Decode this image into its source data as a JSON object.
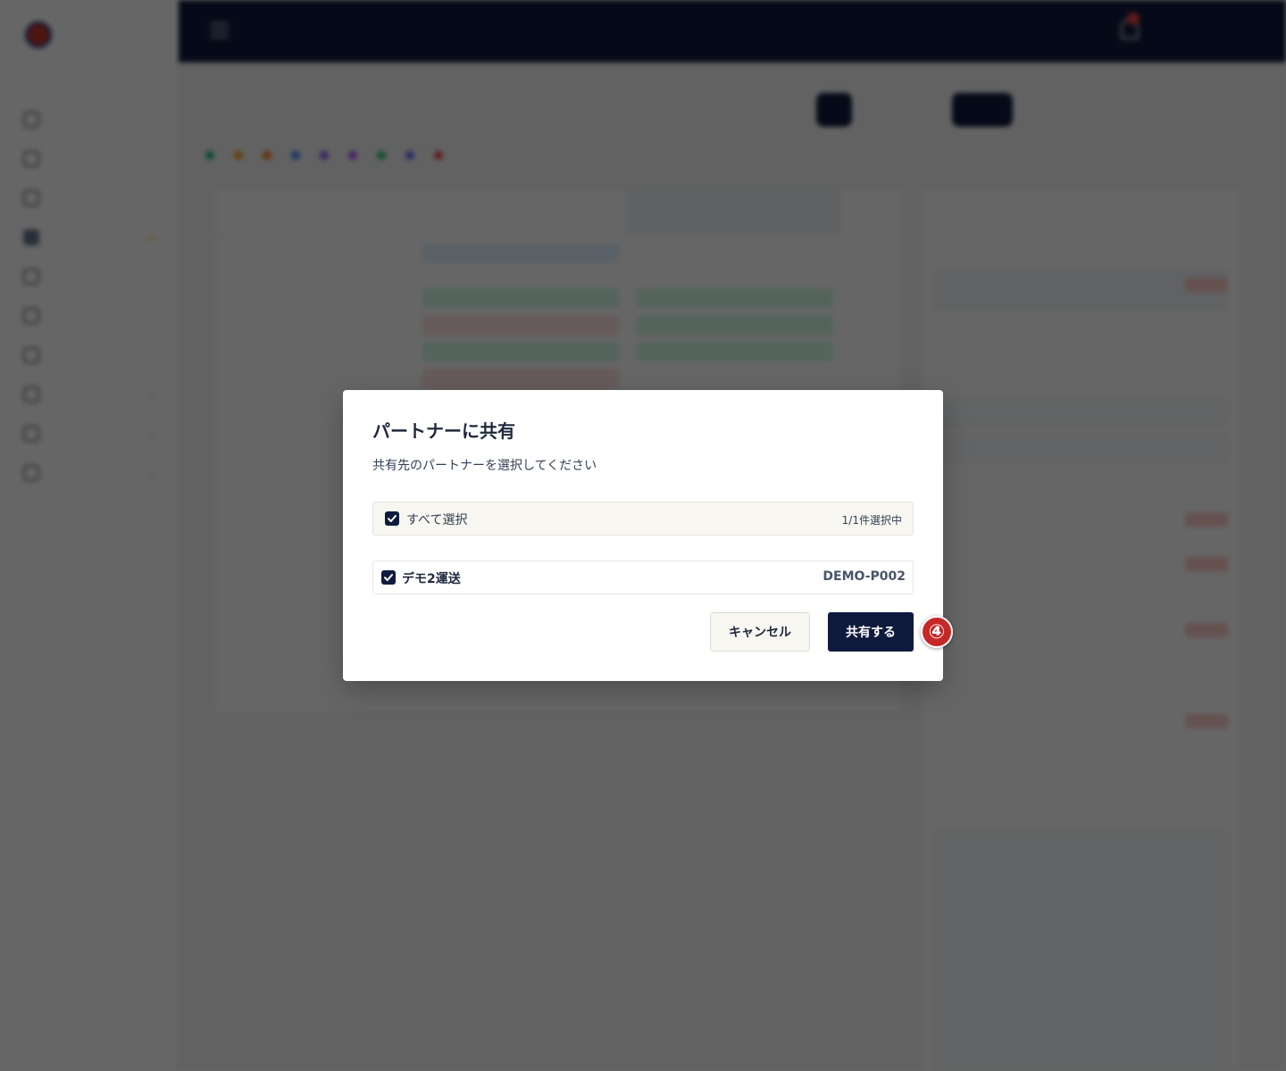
{
  "dialog": {
    "title": "パートナーに共有",
    "subtitle": "共有先のパートナーを選択してください",
    "select_all_label": "すべて選択",
    "selected_count": "1/1件選択中",
    "partners": [
      {
        "name": "デモ2運送",
        "code": "DEMO-P002",
        "checked": true
      }
    ],
    "cancel_label": "キャンセル",
    "share_label": "共有する"
  },
  "annotation": {
    "step_badge": "④"
  },
  "colors": {
    "primary": "#0f1b3d",
    "overlay": "rgba(0,0,0,0.6)",
    "badge": "#c62828",
    "select_all_bg": "#f7f6f1"
  },
  "icons": {
    "checkbox": "check-icon"
  }
}
